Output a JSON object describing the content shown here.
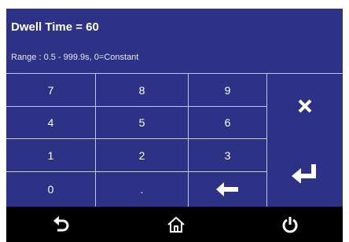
{
  "header": {
    "title": "Dwell Time = 60",
    "range": "Range : 0.5 - 999.9s, 0=Constant"
  },
  "keypad": {
    "k7": "7",
    "k8": "8",
    "k9": "9",
    "k4": "4",
    "k5": "5",
    "k6": "6",
    "k1": "1",
    "k2": "2",
    "k3": "3",
    "k0": "0",
    "kdot": "."
  },
  "icons": {
    "clear": "close-icon",
    "backspace": "arrow-left-icon",
    "enter": "enter-icon",
    "back": "back-icon",
    "home": "home-icon",
    "power": "power-icon"
  },
  "colors": {
    "panel": "#2e3286",
    "grid": "#c9cbe6",
    "bar": "#000000"
  }
}
